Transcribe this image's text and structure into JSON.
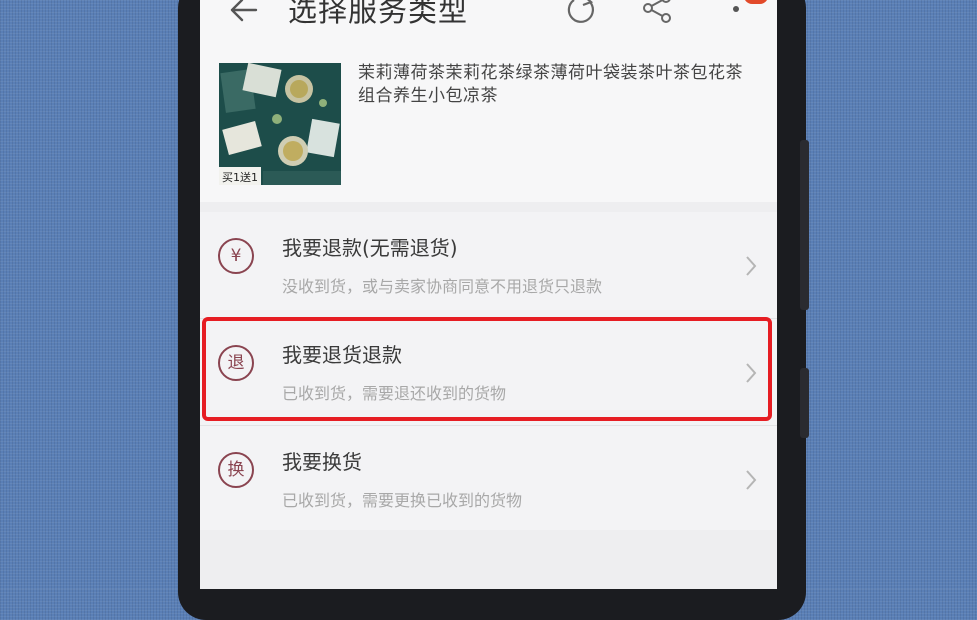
{
  "header": {
    "title": "选择服务类型",
    "icons": [
      "back-arrow-icon",
      "refresh-icon",
      "share-icon",
      "more-vertical-icon"
    ]
  },
  "product": {
    "title": "茉莉薄荷茶茉莉花茶绿茶薄荷叶袋装茶叶茶包花茶组合养生小包凉茶",
    "thumb_promo": "买1送1"
  },
  "options": [
    {
      "icon_char": "¥",
      "icon_name": "refund-money-icon",
      "title": "我要退款(无需退货)",
      "desc": "没收到货，或与卖家协商同意不用退货只退款"
    },
    {
      "icon_char": "退",
      "icon_name": "return-icon",
      "title": "我要退货退款",
      "desc": "已收到货，需要退还收到的货物"
    },
    {
      "icon_char": "换",
      "icon_name": "exchange-icon",
      "title": "我要换货",
      "desc": "已收到货，需要更换已收到的货物"
    }
  ],
  "colors": {
    "accent_icon": "#8a4450",
    "highlight": "#e61d23",
    "badge": "#e24a2a"
  }
}
